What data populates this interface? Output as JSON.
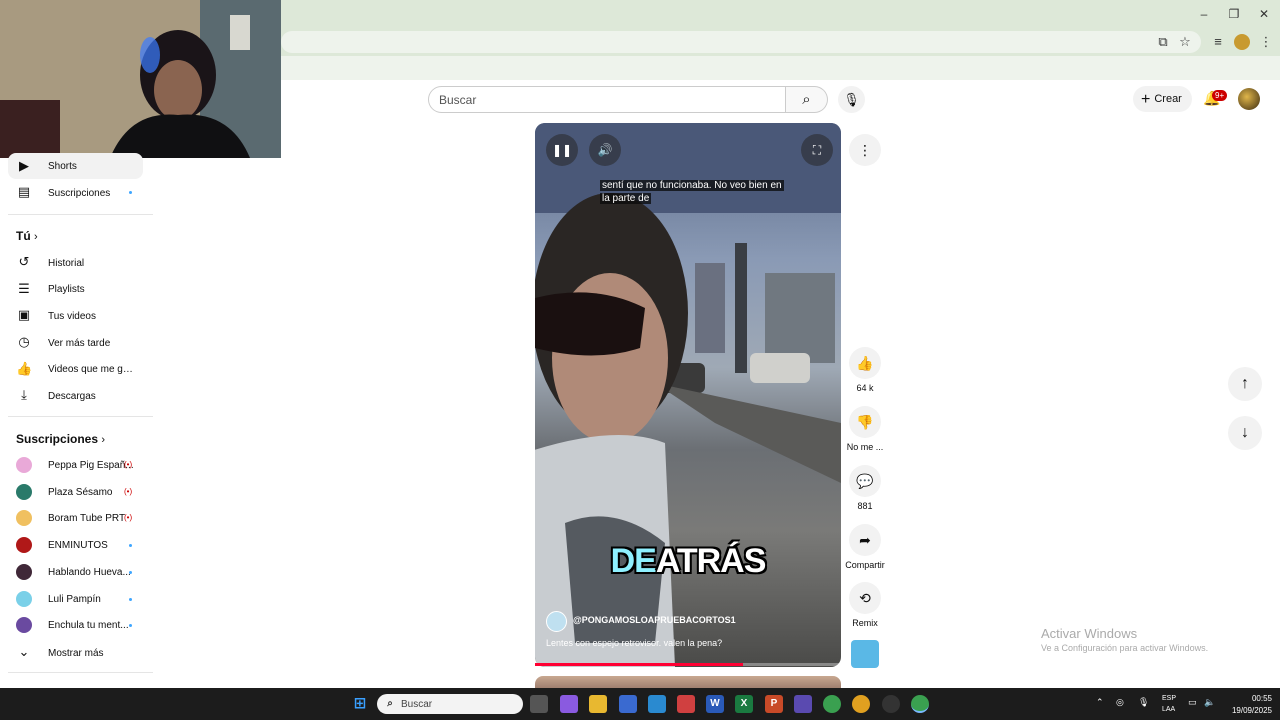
{
  "header": {
    "search_placeholder": "Buscar",
    "create_label": "Crear",
    "notification_count": "9+"
  },
  "sidebar": {
    "shorts": "Shorts",
    "subscriptions": "Suscripciones",
    "you_heading": "Tú",
    "you_items": [
      {
        "label": "Historial",
        "icon": "history-icon"
      },
      {
        "label": "Playlists",
        "icon": "playlists-icon"
      },
      {
        "label": "Tus videos",
        "icon": "your-videos-icon"
      },
      {
        "label": "Ver más tarde",
        "icon": "watch-later-icon"
      },
      {
        "label": "Videos que me gust...",
        "icon": "liked-videos-icon"
      },
      {
        "label": "Descargas",
        "icon": "downloads-icon"
      }
    ],
    "subs_heading": "Suscripciones",
    "subs": [
      {
        "label": "Peppa Pig Españ...",
        "status": "live",
        "color": "#e9a9d8"
      },
      {
        "label": "Plaza Sésamo",
        "status": "live",
        "color": "#2a7a6a"
      },
      {
        "label": "Boram Tube PRT",
        "status": "live",
        "color": "#f0c060"
      },
      {
        "label": "ENMINUTOS",
        "status": "new",
        "color": "#b01818"
      },
      {
        "label": "Hablando Hueva...",
        "status": "new",
        "color": "#402838"
      },
      {
        "label": "Luli Pampín",
        "status": "new",
        "color": "#7ad0e8"
      },
      {
        "label": "Enchula tu ment...",
        "status": "new",
        "color": "#6a4aa0"
      }
    ],
    "show_more": "Mostrar más"
  },
  "short": {
    "caption_line1": "sentí que no funcionaba. No veo bien en",
    "caption_line2": "la parte de",
    "overlay_word1": "DE",
    "overlay_word2": "ATRÁS",
    "channel": "@PONGAMOSLOAPRUEBACORTOS1",
    "title": "Lentes con espejo retrovisor. valen la pena?",
    "progress": 0.68
  },
  "actions": {
    "likes": "64 k",
    "dislike": "No me ...",
    "comments": "881",
    "share": "Compartir",
    "remix": "Remix"
  },
  "watermark": {
    "line1": "Activar Windows",
    "line2": "Ve a Configuración para activar Windows."
  },
  "taskbar": {
    "search": "Buscar",
    "lang1": "ESP",
    "lang2": "LAA",
    "time": "00:55",
    "date": "19/09/2025"
  }
}
